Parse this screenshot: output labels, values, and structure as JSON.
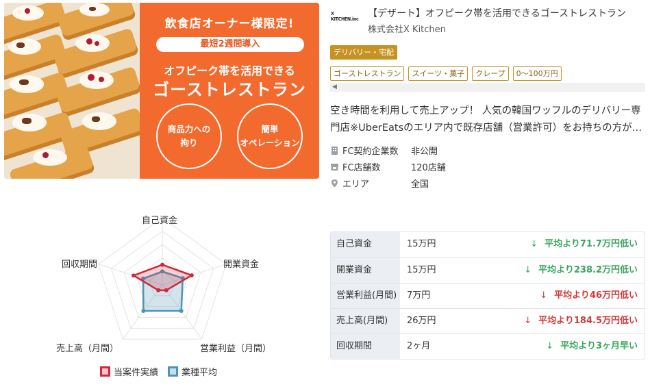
{
  "banner": {
    "headline": "飲食店オーナー様限定!",
    "pill": "最短2週間導入",
    "sub": "オフピーク帯を活用できる",
    "main": "ゴーストレストラン",
    "circle1": "商品力への\n拘り",
    "circle2": "簡単\nオペレーション"
  },
  "listing": {
    "logo_text": "X KITCHEN.inc",
    "title": "【デザート】オフピーク帯を活用できるゴーストレストラン",
    "company": "株式会社X Kitchen",
    "category": "デリバリー・宅配",
    "tags": [
      "ゴーストレストラン",
      "スイーツ・菓子",
      "クレープ",
      "0～100万円"
    ],
    "description": "空き時間を利用して売上アップ！ 人気の韓国ワッフルのデリバリー専門店※UberEatsのエリア内で既存店舗（営業許可）をお持ちの方が…",
    "info": [
      {
        "icon": "building-icon",
        "label": "FC契約企業数",
        "value": "非公開"
      },
      {
        "icon": "store-icon",
        "label": "FC店舗数",
        "value": "120店舗"
      },
      {
        "icon": "map-pin-icon",
        "label": "エリア",
        "value": "全国"
      }
    ]
  },
  "radar": {
    "axes": [
      "自己資金",
      "開業資金",
      "営業利益（月間）",
      "売上高（月間）",
      "回収期間"
    ],
    "legend": [
      "当案件実績",
      "業種平均"
    ],
    "colors": {
      "case": "#d0273b",
      "avg": "#4e93b8"
    }
  },
  "chart_data": {
    "type": "radar",
    "categories": [
      "自己資金",
      "開業資金",
      "営業利益（月間）",
      "売上高（月間）",
      "回収期間"
    ],
    "series": [
      {
        "name": "当案件実績",
        "values": [
          0.3,
          0.46,
          0.1,
          0.1,
          0.45
        ]
      },
      {
        "name": "業種平均",
        "values": [
          0.2,
          0.32,
          0.48,
          0.48,
          0.3
        ]
      }
    ],
    "range": [
      0,
      1
    ]
  },
  "compare": {
    "rows": [
      {
        "label": "自己資金",
        "value": "15万円",
        "diff": "平均より71.7万円低い",
        "arrow": "↓",
        "color": "#3aa55b"
      },
      {
        "label": "開業資金",
        "value": "15万円",
        "diff": "平均より238.2万円低い",
        "arrow": "↓",
        "color": "#3aa55b"
      },
      {
        "label": "営業利益(月間)",
        "value": "7万円",
        "diff": "平均より46万円低い",
        "arrow": "↓",
        "color": "#d33a3a"
      },
      {
        "label": "売上高(月間)",
        "value": "26万円",
        "diff": "平均より184.5万円低い",
        "arrow": "↓",
        "color": "#d33a3a"
      },
      {
        "label": "回収期間",
        "value": "2ヶ月",
        "diff": "平均より3ヶ月早い",
        "arrow": "↓",
        "color": "#3aa55b"
      }
    ]
  }
}
